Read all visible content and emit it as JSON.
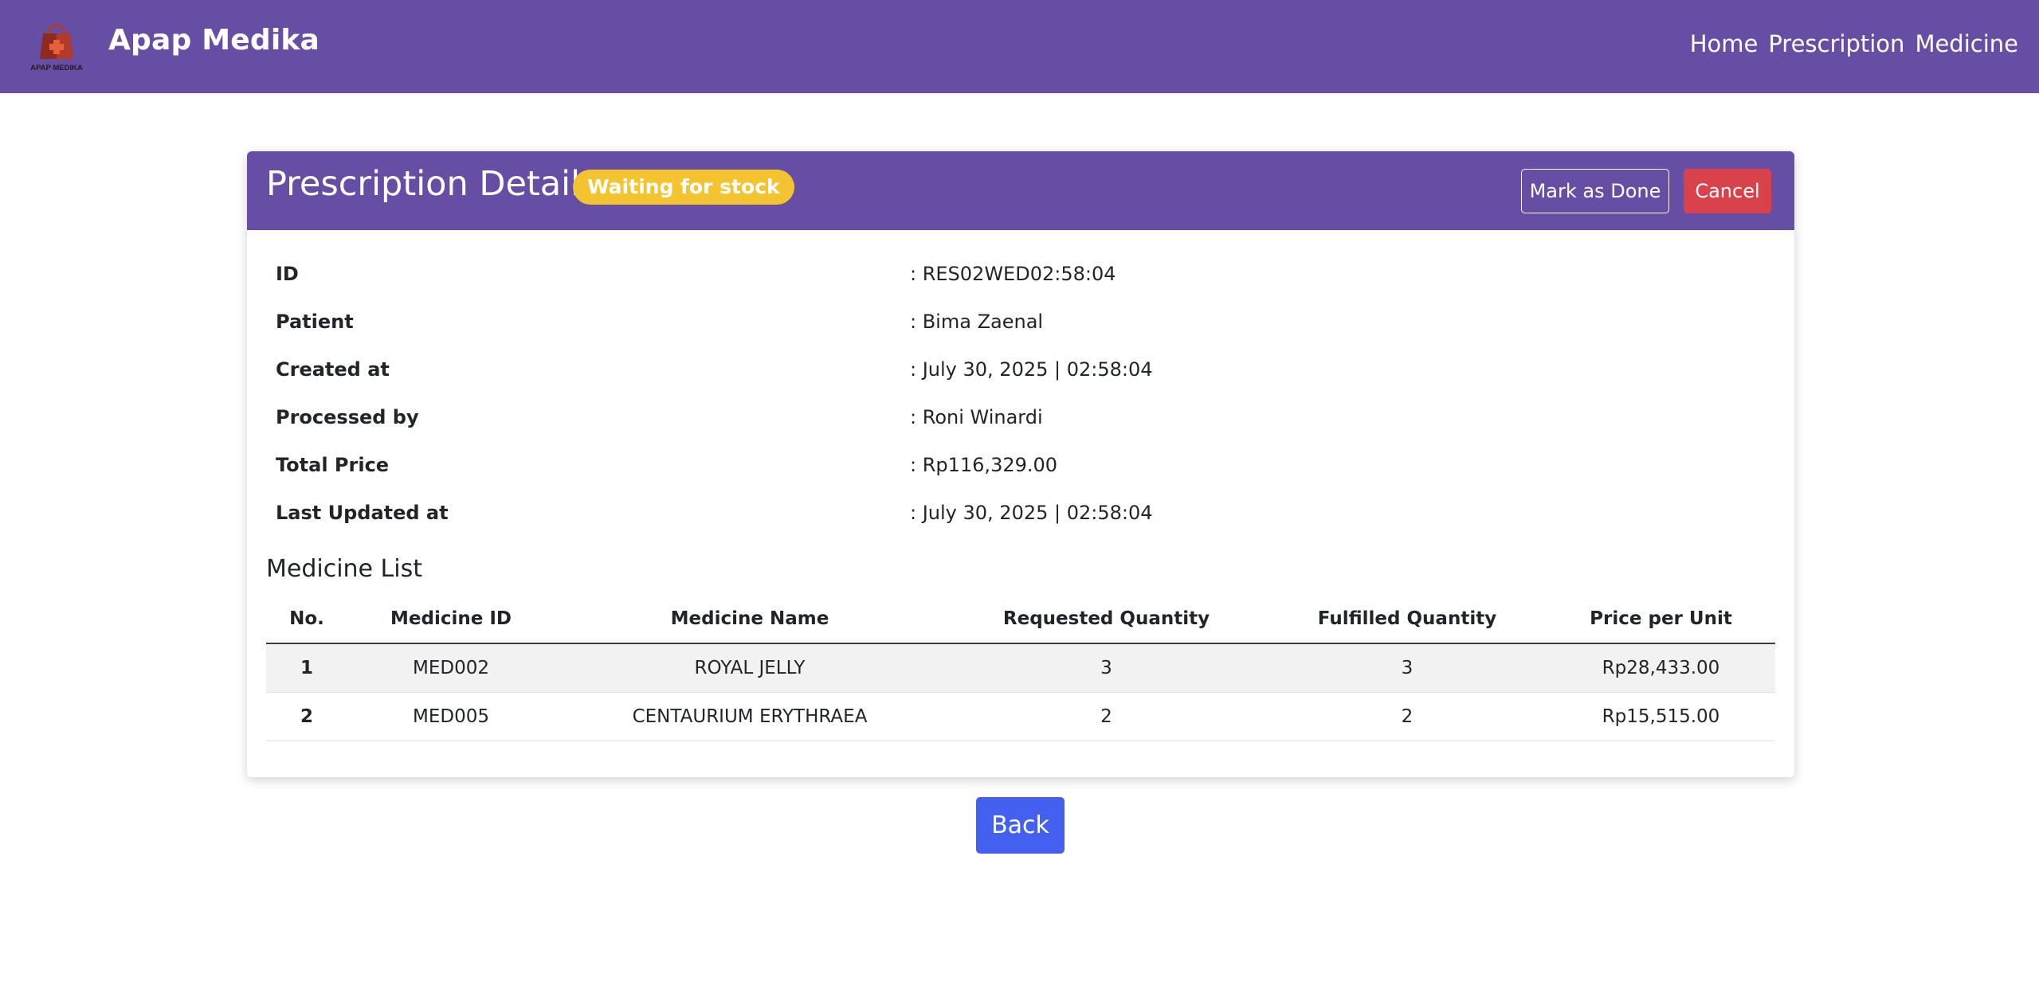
{
  "app": {
    "brand": "Apap Medika",
    "logo_text": "APAP MEDIKA"
  },
  "nav": {
    "links": [
      "Home",
      "Prescription",
      "Medicine"
    ]
  },
  "card": {
    "title": "Prescription Detail",
    "status": "Waiting for stock",
    "mark_done_label": "Mark as Done",
    "cancel_label": "Cancel"
  },
  "details": [
    {
      "label": "ID",
      "value": ": RES02WED02:58:04"
    },
    {
      "label": "Patient",
      "value": ": Bima Zaenal"
    },
    {
      "label": "Created at",
      "value": ": July 30, 2025 | 02:58:04"
    },
    {
      "label": "Processed by",
      "value": ": Roni Winardi"
    },
    {
      "label": "Total Price",
      "value": ": Rp116,329.00"
    },
    {
      "label": "Last Updated at",
      "value": ": July 30, 2025 | 02:58:04"
    }
  ],
  "medicine_list": {
    "title": "Medicine List",
    "columns": [
      "No.",
      "Medicine ID",
      "Medicine Name",
      "Requested Quantity",
      "Fulfilled Quantity",
      "Price per Unit"
    ],
    "rows": [
      [
        "1",
        "MED002",
        "ROYAL JELLY",
        "3",
        "3",
        "Rp28,433.00"
      ],
      [
        "2",
        "MED005",
        "CENTAURIUM ERYTHRAEA",
        "2",
        "2",
        "Rp15,515.00"
      ]
    ]
  },
  "back_label": "Back",
  "colors": {
    "primary": "#654ea3",
    "badge": "#f4c430",
    "danger": "#d9414b",
    "back": "#4460ee"
  }
}
